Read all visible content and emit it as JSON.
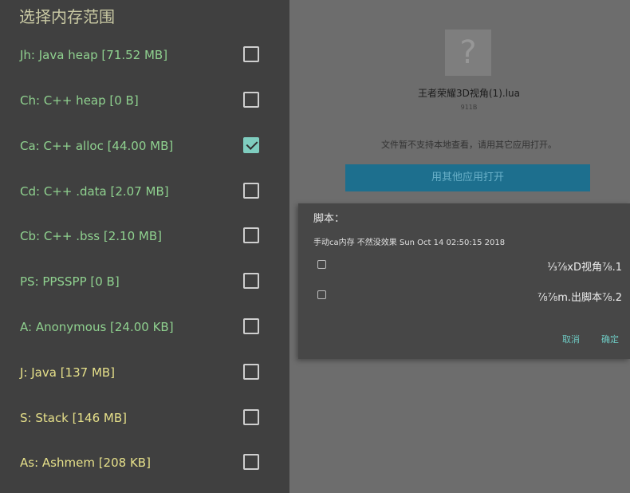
{
  "memory_panel": {
    "title": "选择内存范围",
    "items": [
      {
        "label": "Jh: Java heap [71.52 MB]",
        "checked": false,
        "color": "#8fd18f"
      },
      {
        "label": "Ch: C++ heap [0 B]",
        "checked": false,
        "color": "#8fd18f"
      },
      {
        "label": "Ca: C++ alloc [44.00 MB]",
        "checked": true,
        "color": "#8fd18f"
      },
      {
        "label": "Cd: C++ .data [2.07 MB]",
        "checked": false,
        "color": "#8fd18f"
      },
      {
        "label": "Cb: C++ .bss [2.10 MB]",
        "checked": false,
        "color": "#8fd18f"
      },
      {
        "label": "PS: PPSSPP [0 B]",
        "checked": false,
        "color": "#8fd18f"
      },
      {
        "label": "A: Anonymous [24.00 KB]",
        "checked": false,
        "color": "#8fd18f"
      },
      {
        "label": "J: Java [137 MB]",
        "checked": false,
        "color": "#e6e08a"
      },
      {
        "label": "S: Stack [146 MB]",
        "checked": false,
        "color": "#e6e08a"
      },
      {
        "label": "As: Ashmem [208 KB]",
        "checked": false,
        "color": "#e6e08a"
      }
    ]
  },
  "file_view": {
    "icon": "question-file-icon",
    "icon_glyph": "?",
    "file_name": "王者荣耀3D视角(1).lua",
    "file_size": "911B",
    "note": "文件暂不支持本地查看，请用其它应用打开。",
    "open_button": "用其他应用打开"
  },
  "script_dialog": {
    "title": "脚本：",
    "subtitle": "手动ca内存 不然没效果 Sun Oct 14 02:50:15 2018",
    "options": [
      {
        "label": "⅓⅞xD视角⅞.1",
        "checked": false
      },
      {
        "label": "⅞⅞m.出脚本⅞.2",
        "checked": false
      }
    ],
    "cancel_label": "取消",
    "confirm_label": "确定"
  }
}
